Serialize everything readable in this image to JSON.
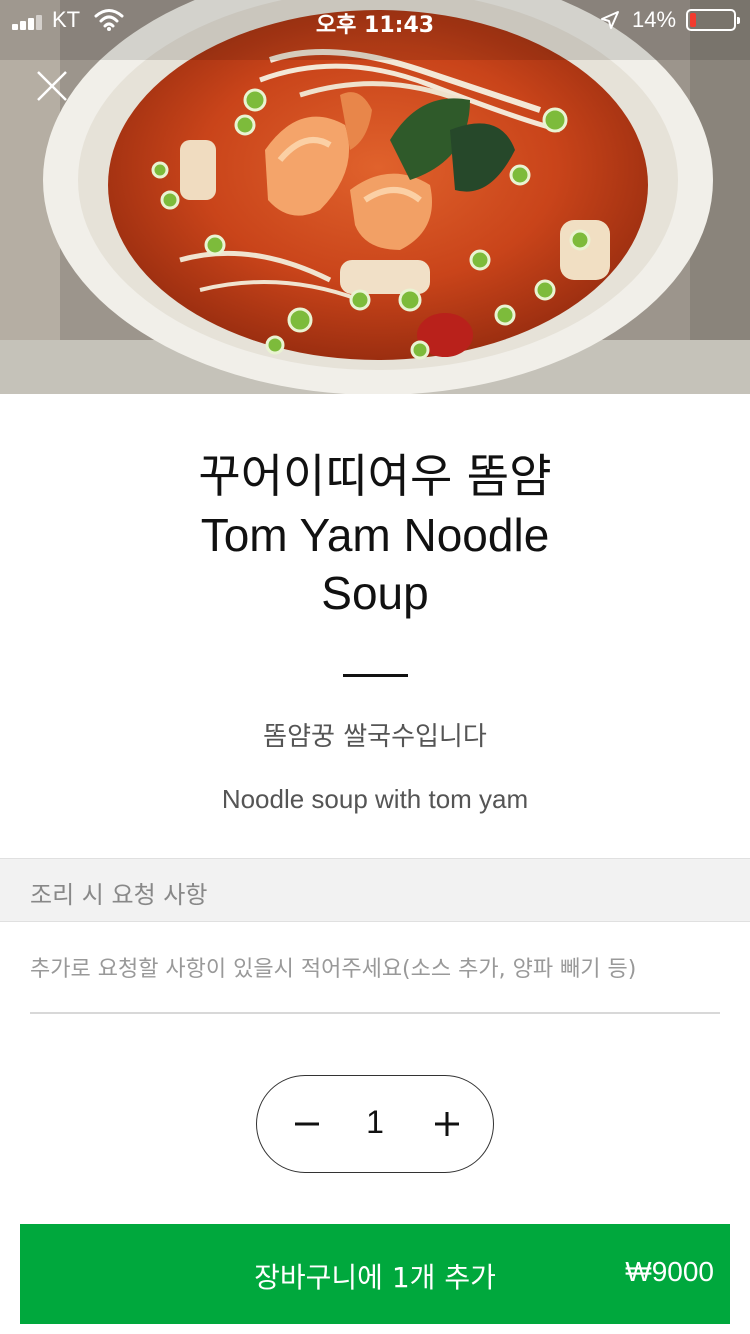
{
  "status_bar": {
    "carrier": "KT",
    "time": "오후 11:43",
    "battery_percent": "14%",
    "battery_level": 0.14
  },
  "hero": {
    "image_icon": "tom-yam-noodle-soup-photo",
    "close_icon": "close-icon"
  },
  "item": {
    "name_ko": "꾸어이띠여우 똠얌",
    "name_en": "Tom Yam Noodle Soup",
    "desc_ko": "똠얌꿍 쌀국수입니다",
    "desc_en": "Noodle soup with tom yam"
  },
  "request": {
    "header": "조리 시 요청 사항",
    "placeholder": "추가로 요청할 사항이 있을시 적어주세요(소스 추가, 양파 빼기 등)",
    "value": ""
  },
  "stepper": {
    "quantity": "1",
    "minus_icon": "minus-icon",
    "plus_icon": "plus-icon"
  },
  "cart": {
    "label": "장바구니에 1개 추가",
    "price": "₩9000",
    "color": "#00a83d"
  }
}
